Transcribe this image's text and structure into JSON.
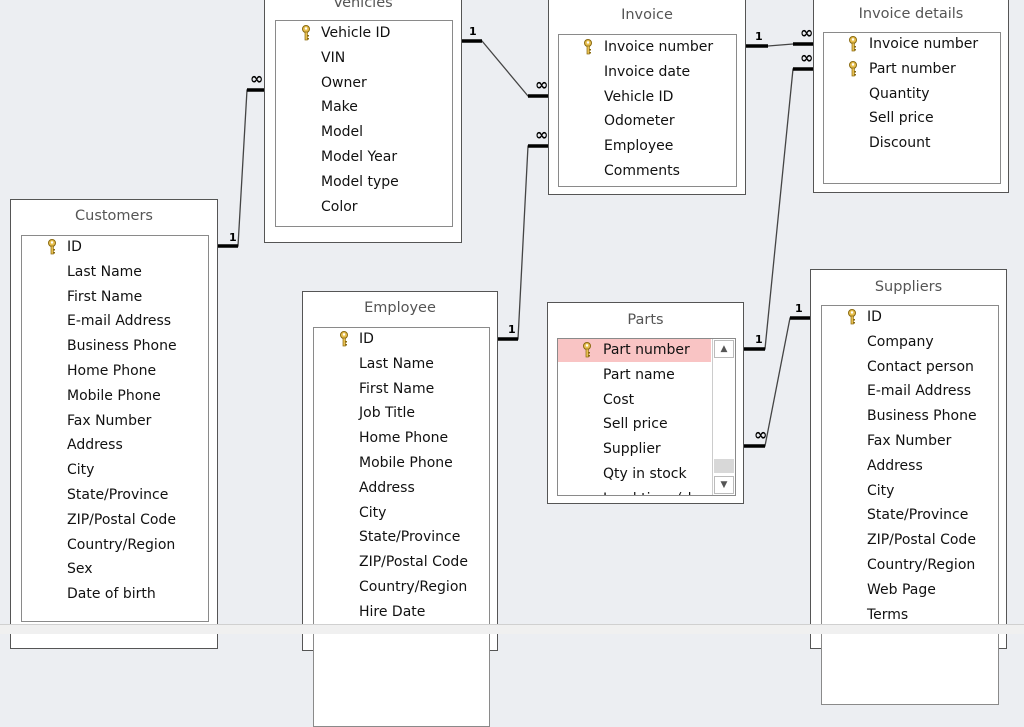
{
  "tables": [
    {
      "id": "vehicles",
      "title": "Vehicles",
      "keys": [
        0
      ],
      "fields": [
        "Vehicle ID",
        "VIN",
        "Owner",
        "Make",
        "Model",
        "Model Year",
        "Model type",
        "Color"
      ]
    },
    {
      "id": "invoice",
      "title": "Invoice",
      "keys": [
        0
      ],
      "fields": [
        "Invoice number",
        "Invoice date",
        "Vehicle ID",
        "Odometer",
        "Employee",
        "Comments"
      ]
    },
    {
      "id": "invoice-details",
      "title": "Invoice details",
      "keys": [
        0,
        1
      ],
      "fields": [
        "Invoice number",
        "Part number",
        "Quantity",
        "Sell price",
        "Discount"
      ]
    },
    {
      "id": "customers",
      "title": "Customers",
      "keys": [
        0
      ],
      "fields": [
        "ID",
        "Last Name",
        "First Name",
        "E-mail Address",
        "Business Phone",
        "Home Phone",
        "Mobile Phone",
        "Fax Number",
        "Address",
        "City",
        "State/Province",
        "ZIP/Postal Code",
        "Country/Region",
        "Sex",
        "Date of birth"
      ]
    },
    {
      "id": "employee",
      "title": "Employee",
      "keys": [
        0
      ],
      "fields": [
        "ID",
        "Last Name",
        "First Name",
        "Job Title",
        "Home Phone",
        "Mobile Phone",
        "Address",
        "City",
        "State/Province",
        "ZIP/Postal Code",
        "Country/Region",
        "Hire Date"
      ]
    },
    {
      "id": "parts",
      "title": "Parts",
      "keys": [
        0
      ],
      "selected": 0,
      "scrollable": true,
      "fields": [
        "Part number",
        "Part name",
        "Cost",
        "Sell price",
        "Supplier",
        "Qty in stock",
        "Lead time (days)"
      ]
    },
    {
      "id": "suppliers",
      "title": "Suppliers",
      "keys": [
        0
      ],
      "fields": [
        "ID",
        "Company",
        "Contact person",
        "E-mail Address",
        "Business Phone",
        "Fax Number",
        "Address",
        "City",
        "State/Province",
        "ZIP/Postal Code",
        "Country/Region",
        "Web Page",
        "Terms"
      ]
    }
  ],
  "relationships": [
    {
      "from": "customers.ID",
      "to": "vehicles.Owner",
      "one": "1",
      "many": "∞"
    },
    {
      "from": "vehicles.Vehicle ID",
      "to": "invoice.Vehicle ID",
      "one": "1",
      "many": "∞"
    },
    {
      "from": "employee.ID",
      "to": "invoice.Employee",
      "one": "1",
      "many": "∞"
    },
    {
      "from": "invoice.Invoice number",
      "to": "invoice-details.Invoice number",
      "one": "1",
      "many": "∞"
    },
    {
      "from": "parts.Part number",
      "to": "invoice-details.Part number",
      "one": "1",
      "many": "∞"
    },
    {
      "from": "suppliers.ID",
      "to": "parts.Supplier",
      "one": "1",
      "many": "∞"
    }
  ],
  "icons": {
    "primary_key": "key-icon",
    "scroll_up": "scroll-up-arrow",
    "scroll_down": "scroll-down-arrow"
  },
  "colors": {
    "background": "#eceef2",
    "selected_row": "#f9c4c4",
    "key": "#b08a10"
  }
}
